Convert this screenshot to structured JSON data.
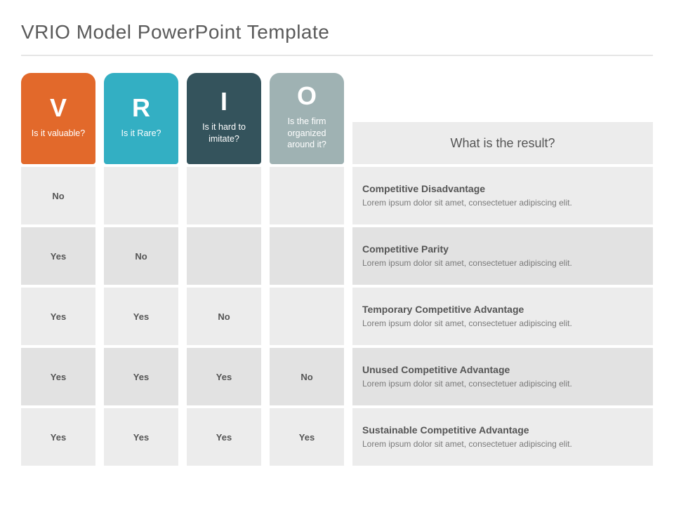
{
  "title": "VRIO Model PowerPoint Template",
  "resultHeader": "What is the result?",
  "columns": [
    {
      "letter": "V",
      "question": "Is it valuable?",
      "colorClass": "v"
    },
    {
      "letter": "R",
      "question": "Is it Rare?",
      "colorClass": "r"
    },
    {
      "letter": "I",
      "question": "Is it hard to imitate?",
      "colorClass": "i"
    },
    {
      "letter": "O",
      "question": "Is the firm organized around it?",
      "colorClass": "o"
    }
  ],
  "rows": [
    {
      "cells": [
        "No",
        "",
        "",
        ""
      ],
      "resultTitle": "Competitive Disadvantage",
      "resultBody": "Lorem ipsum dolor sit amet, consectetuer adipiscing elit."
    },
    {
      "cells": [
        "Yes",
        "No",
        "",
        ""
      ],
      "resultTitle": "Competitive Parity",
      "resultBody": "Lorem ipsum dolor sit amet, consectetuer adipiscing elit."
    },
    {
      "cells": [
        "Yes",
        "Yes",
        "No",
        ""
      ],
      "resultTitle": "Temporary Competitive Advantage",
      "resultBody": "Lorem ipsum dolor sit amet, consectetuer adipiscing elit."
    },
    {
      "cells": [
        "Yes",
        "Yes",
        "Yes",
        "No"
      ],
      "resultTitle": "Unused Competitive Advantage",
      "resultBody": "Lorem ipsum dolor sit amet, consectetuer adipiscing elit."
    },
    {
      "cells": [
        "Yes",
        "Yes",
        "Yes",
        "Yes"
      ],
      "resultTitle": "Sustainable Competitive Advantage",
      "resultBody": "Lorem ipsum dolor sit amet, consectetuer adipiscing elit."
    }
  ],
  "colors": {
    "v": "#e2692b",
    "r": "#33afc3",
    "i": "#34535c",
    "o": "#9fb2b3",
    "shade1": "#ececec",
    "shade2": "#e2e2e2"
  },
  "chart_data": {
    "type": "table",
    "title": "VRIO Model",
    "column_labels": [
      "Valuable?",
      "Rare?",
      "Hard to imitate?",
      "Organized around it?"
    ],
    "result_label": "What is the result?",
    "matrix": [
      {
        "V": "No",
        "R": "",
        "I": "",
        "O": "",
        "result": "Competitive Disadvantage"
      },
      {
        "V": "Yes",
        "R": "No",
        "I": "",
        "O": "",
        "result": "Competitive Parity"
      },
      {
        "V": "Yes",
        "R": "Yes",
        "I": "No",
        "O": "",
        "result": "Temporary Competitive Advantage"
      },
      {
        "V": "Yes",
        "R": "Yes",
        "I": "Yes",
        "O": "No",
        "result": "Unused Competitive Advantage"
      },
      {
        "V": "Yes",
        "R": "Yes",
        "I": "Yes",
        "O": "Yes",
        "result": "Sustainable Competitive Advantage"
      }
    ]
  }
}
